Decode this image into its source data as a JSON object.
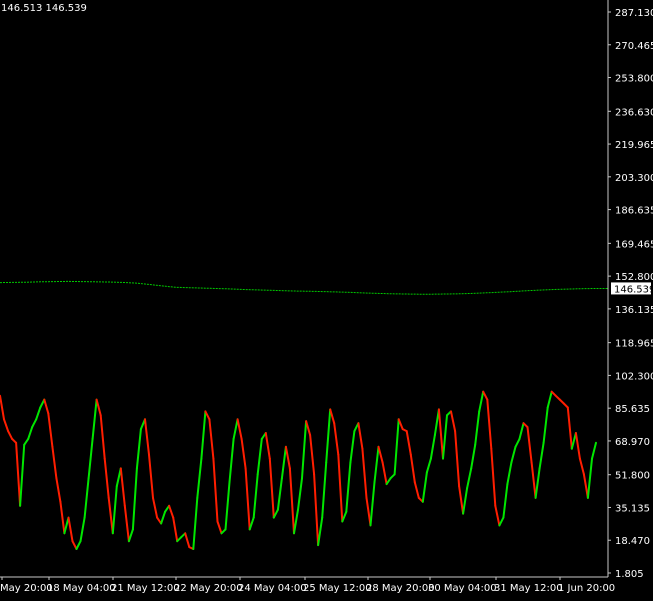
{
  "header": {
    "quote": "146.513 146.539"
  },
  "chart_data": {
    "type": "line",
    "ylim": [
      1.805,
      295.0
    ],
    "y_ticks": [
      "287.130",
      "270.465",
      "253.800",
      "236.630",
      "219.965",
      "203.300",
      "186.635",
      "169.465",
      "152.800",
      "136.135",
      "118.965",
      "102.300",
      "85.635",
      "68.970",
      "51.800",
      "35.135",
      "18.470",
      "1.805"
    ],
    "x_ticks": [
      "May 20:00",
      "18 May 04:00",
      "21 May 12:00",
      "22 May 20:00",
      "24 May 04:00",
      "25 May 12:00",
      "28 May 20:00",
      "30 May 04:00",
      "31 May 12:00",
      "1 Jun 20:00"
    ],
    "current_price": "146.539",
    "price_series": {
      "color": "#00c800",
      "values": [
        149.5,
        149.6,
        149.7,
        149.9,
        150.0,
        150.1,
        150.0,
        149.9,
        149.8,
        149.6,
        149.3,
        148.6,
        147.8,
        147.1,
        146.9,
        146.7,
        146.5,
        146.3,
        146.0,
        145.8,
        145.6,
        145.4,
        145.2,
        145.1,
        144.9,
        144.7,
        144.5,
        144.2,
        144.0,
        143.8,
        143.7,
        143.6,
        143.6,
        143.7,
        143.8,
        144.0,
        144.3,
        144.6,
        145.0,
        145.4,
        145.7,
        146.0,
        146.2,
        146.4,
        146.5,
        146.5
      ]
    },
    "oscillator": {
      "up_color": "#00e600",
      "down_color": "#ff1e00",
      "values": [
        92,
        80,
        74,
        70,
        68,
        36,
        67,
        70,
        76,
        80,
        86,
        90,
        83,
        66,
        50,
        38,
        22,
        30,
        18,
        14,
        18,
        30,
        50,
        70,
        90,
        82,
        60,
        40,
        22,
        46,
        55,
        36,
        18,
        24,
        55,
        75,
        80,
        62,
        40,
        30,
        27,
        33,
        36,
        30,
        18,
        20,
        22,
        15,
        14,
        40,
        60,
        84,
        80,
        60,
        28,
        22,
        24,
        48,
        70,
        80,
        70,
        55,
        24,
        30,
        52,
        70,
        73,
        60,
        30,
        34,
        50,
        66,
        55,
        22,
        34,
        50,
        79,
        72,
        52,
        16,
        30,
        58,
        85,
        78,
        62,
        28,
        33,
        58,
        74,
        78,
        65,
        40,
        26,
        48,
        66,
        58,
        47,
        50,
        52,
        80,
        75,
        74,
        62,
        48,
        40,
        38,
        53,
        60,
        72,
        85,
        60,
        82,
        84,
        74,
        46,
        32,
        45,
        55,
        67,
        84,
        94,
        90,
        65,
        36,
        26,
        30,
        47,
        58,
        66,
        70,
        78,
        76,
        58,
        40,
        55,
        68,
        86,
        94,
        92,
        90,
        88,
        86,
        65,
        73,
        60,
        52,
        40,
        60,
        68
      ]
    }
  }
}
